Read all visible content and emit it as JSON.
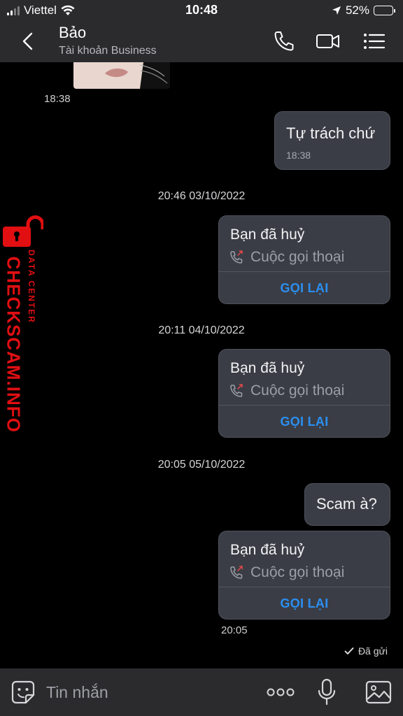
{
  "status_bar": {
    "carrier": "Viettel",
    "time": "10:48",
    "battery_percent": "52%",
    "battery_level": 0.52,
    "icons": [
      "signal-icon",
      "wifi-icon",
      "location-arrow-icon",
      "battery-icon"
    ]
  },
  "header": {
    "contact_name": "Bảo",
    "contact_subtitle": "Tài khoản Business",
    "icons": [
      "back-chevron-icon",
      "phone-icon",
      "video-camera-icon",
      "menu-list-icon"
    ]
  },
  "chat": {
    "photo_time": "18:38",
    "messages": [
      {
        "text": "Tự trách chứ",
        "time": "18:38"
      },
      {
        "text": "Scam à?"
      }
    ],
    "date_separators": [
      "20:46 03/10/2022",
      "20:11 04/10/2022",
      "20:05 05/10/2022"
    ],
    "calls": [
      {
        "title": "Bạn đã huỷ",
        "description": "Cuộc gọi thoại",
        "action": "GỌI LẠI"
      },
      {
        "title": "Bạn đã huỷ",
        "description": "Cuộc gọi thoại",
        "action": "GỌI LẠI"
      },
      {
        "title": "Bạn đã huỷ",
        "description": "Cuộc gọi thoại",
        "action": "GỌI LẠI"
      }
    ],
    "last_time": "20:05",
    "delivery_status": "Đã gửi"
  },
  "watermark": {
    "brand": "CHECKSCAM.INFO",
    "tagline": "DATA CENTER"
  },
  "composer": {
    "placeholder": "Tin nhắn",
    "icons": [
      "emoji-sticker-icon",
      "more-dots-icon",
      "microphone-icon",
      "image-gallery-icon"
    ]
  },
  "colors": {
    "background": "#000000",
    "bar": "#2b2b2e",
    "bubble": "#3a3d45",
    "accent": "#2b8ff2",
    "missed_call_red": "#e5484d",
    "watermark_red": "#e10f12"
  }
}
